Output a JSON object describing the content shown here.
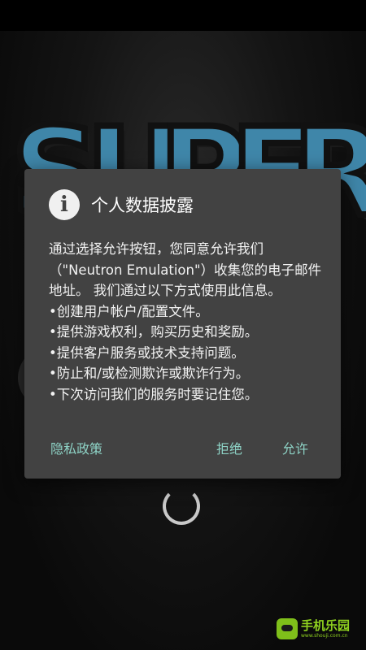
{
  "dialog": {
    "title": "个人数据披露",
    "icon": "info-icon",
    "paragraph": "通过选择允许按钮，您同意允许我们（\"Neutron Emulation\"）收集您的电子邮件地址。 我们通过以下方式使用此信息。",
    "items": [
      "创建用户帐户/配置文件。",
      "提供游戏权利，购买历史和奖励。",
      "提供客户服务或技术支持问题。",
      "防止和/或检测欺诈或欺诈行为。",
      "下次访问我们的服务时要记住您。"
    ],
    "buttons": {
      "privacy": "隐私政策",
      "reject": "拒绝",
      "allow": "允许"
    }
  },
  "background": {
    "logo_text": [
      "S",
      "U",
      "P",
      "E",
      "R"
    ]
  },
  "watermark": {
    "name": "手机乐园",
    "url": "www.shouji.com.cn"
  },
  "colors": {
    "dialog_bg": "#424242",
    "button_text": "#8ed3c6",
    "logo_blue": "#3f86a9",
    "watermark_green": "#8fd11f"
  }
}
